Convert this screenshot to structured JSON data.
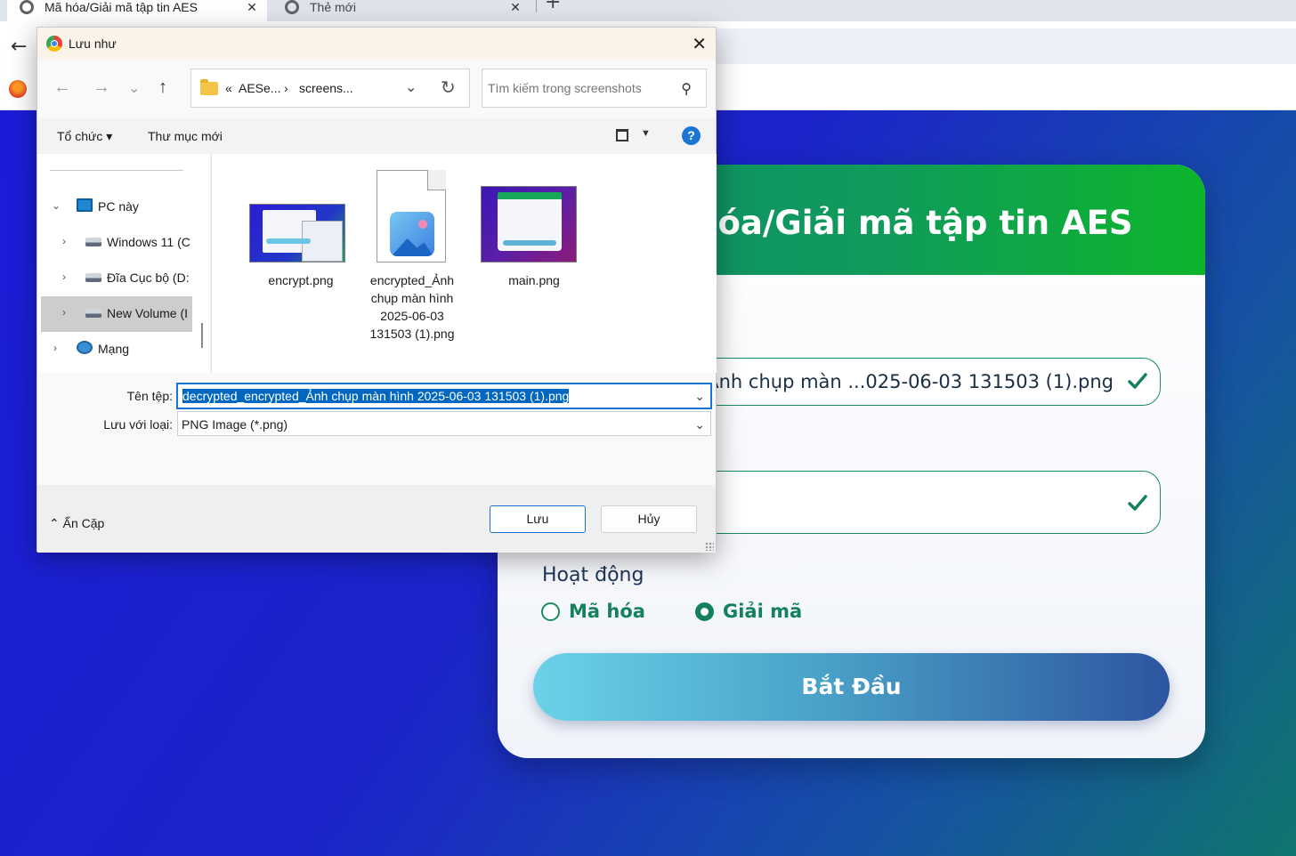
{
  "browser": {
    "tabs": [
      {
        "title": "Mã hóa/Giải mã tập tin AES",
        "active": true
      },
      {
        "title": "Thẻ mới",
        "active": false
      }
    ],
    "new_tab": "+",
    "close_glyph": "✕",
    "back_glyph": "←"
  },
  "page": {
    "title": "Mã hóa/Giải mã tập tin AES",
    "file_field_value": "decrypted_encrypted_Ảnh chụp màn ...025-06-03 131503 (1).png",
    "key_field_value": "",
    "operation_label": "Hoạt động",
    "operations": [
      {
        "label": "Mã hóa",
        "selected": false
      },
      {
        "label": "Giải mã",
        "selected": true
      }
    ],
    "start_button": "Bắt Đầu",
    "colors": {
      "header_start": "#0f8a6e",
      "header_end": "#0db52c",
      "accent": "#15815b",
      "background_start": "#1c1cd8",
      "background_end": "#10756e"
    }
  },
  "dialog": {
    "title": "Lưu như",
    "close_glyph": "✕",
    "path": {
      "prefix": "«",
      "segments": [
        "AESe...",
        "screens..."
      ],
      "separator": "›"
    },
    "search_placeholder": "Tìm kiếm trong screenshots",
    "commands": {
      "organize": "Tổ chức ▾",
      "new_folder": "Thư mục mới"
    },
    "help_glyph": "?",
    "tree": [
      {
        "label": "PC này",
        "icon": "pc-icon",
        "caret": "⌄"
      },
      {
        "label": "Windows 11 (C",
        "icon": "windows-drive-icon",
        "caret": "›"
      },
      {
        "label": "Đĩa Cục bộ (D:",
        "icon": "drive-icon",
        "caret": "›"
      },
      {
        "label": "New Volume (I",
        "icon": "drive-icon",
        "caret": "›",
        "selected": true
      },
      {
        "label": "Mạng",
        "icon": "network-icon",
        "caret": "›"
      }
    ],
    "files": [
      {
        "name": "encrypt.png",
        "kind": "thumbnail"
      },
      {
        "name": "encrypted_Ảnh chụp màn hình 2025-06-03 131503 (1).png",
        "kind": "image-file-icon"
      },
      {
        "name": "main.png",
        "kind": "thumbnail"
      }
    ],
    "filename_label": "Tên tệp:",
    "filename_value": "decrypted_encrypted_Ảnh chụp màn hình 2025-06-03 131503 (1).png",
    "type_label": "Lưu với loại:",
    "type_value": "PNG Image (*.png)",
    "hide_folders": "Ẩn Cặp",
    "save_button": "Lưu",
    "cancel_button": "Hủy"
  }
}
